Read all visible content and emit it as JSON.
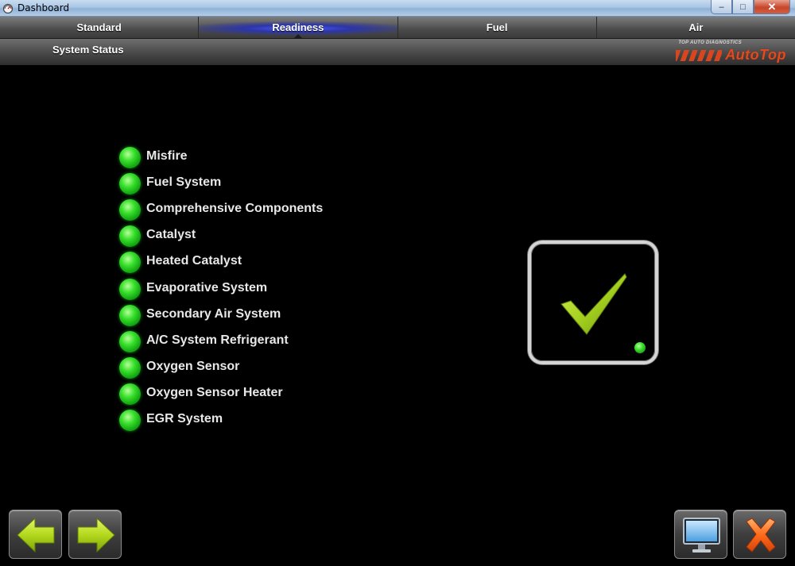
{
  "window": {
    "title": "Dashboard",
    "minimize_glyph": "–",
    "maximize_glyph": "□",
    "close_glyph": "✕"
  },
  "tabs": [
    {
      "label": "Standard",
      "active": false
    },
    {
      "label": "Readiness",
      "active": true
    },
    {
      "label": "Fuel",
      "active": false
    },
    {
      "label": "Air",
      "active": false
    }
  ],
  "section": {
    "title": "System Status"
  },
  "logo": {
    "tagline": "TOP AUTO DIAGNOSTICS",
    "brand": "AutoTop"
  },
  "readiness_items": [
    {
      "label": "Misfire",
      "status": "ready"
    },
    {
      "label": "Fuel System",
      "status": "ready"
    },
    {
      "label": "Comprehensive Components",
      "status": "ready"
    },
    {
      "label": "Catalyst",
      "status": "ready"
    },
    {
      "label": "Heated Catalyst",
      "status": "ready"
    },
    {
      "label": "Evaporative System",
      "status": "ready"
    },
    {
      "label": "Secondary Air System",
      "status": "ready"
    },
    {
      "label": "A/C System Refrigerant",
      "status": "ready"
    },
    {
      "label": "Oxygen Sensor",
      "status": "ready"
    },
    {
      "label": "Oxygen Sensor Heater",
      "status": "ready"
    },
    {
      "label": "EGR System",
      "status": "ready"
    }
  ],
  "overall_status": {
    "icon": "checkmark-icon",
    "state": "ready"
  },
  "buttons": {
    "back_icon": "arrow-left-icon",
    "next_icon": "arrow-right-icon",
    "display_icon": "monitor-icon",
    "exit_icon": "close-x-icon"
  },
  "colors": {
    "led_green": "#39e02c",
    "check_green": "#a6d11f",
    "active_tab": "#4e5dff",
    "brand_orange": "#e14a1f",
    "exit_orange": "#ff6a1a"
  }
}
